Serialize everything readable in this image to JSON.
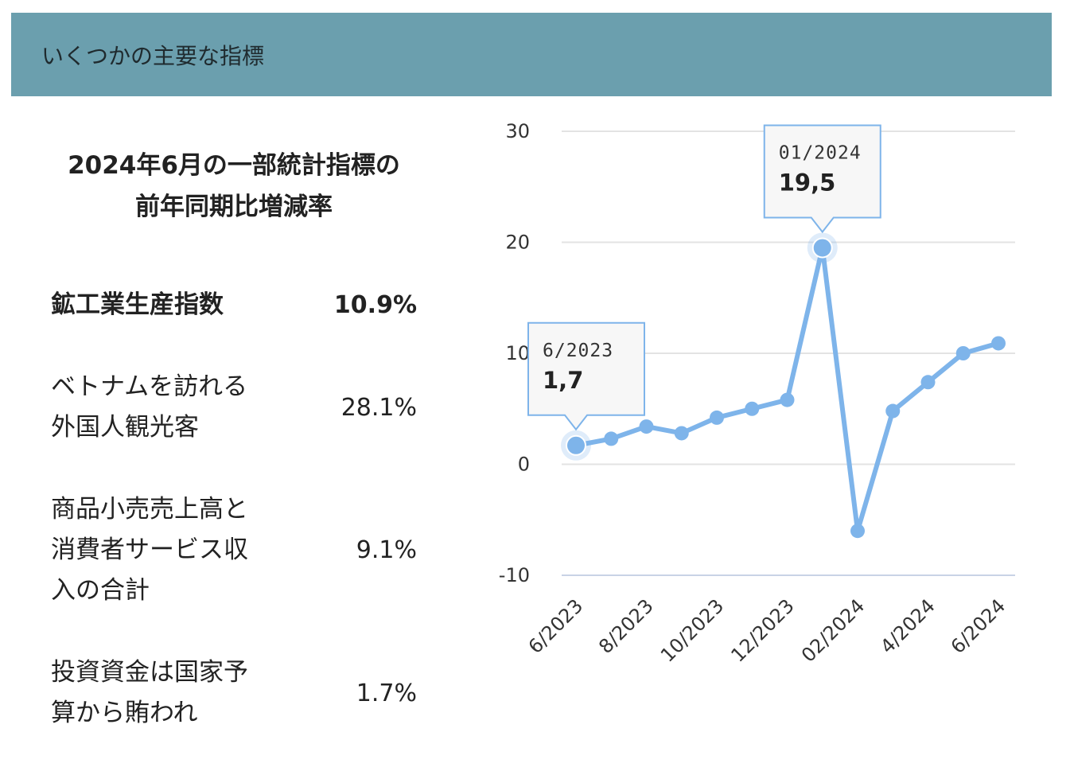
{
  "header": {
    "title": "いくつかの主要な指標"
  },
  "stats": {
    "title_line1": "2024年6月の一部統計指標の",
    "title_line2": "前年同期比増減率",
    "items": [
      {
        "label": "鉱工業生産指数",
        "value": "10.9%"
      },
      {
        "label": "ベトナムを訪れる外国人観光客",
        "value": "28.1%"
      },
      {
        "label": "商品小売売上高と消費者サービス収入の合計",
        "value": "9.1%"
      },
      {
        "label": "投資資金は国家予算から賄われ",
        "value": "1.7%"
      }
    ]
  },
  "colors": {
    "header_bg": "#6b9fae",
    "series": "#7eb4ea",
    "grid": "#e3e3e3"
  },
  "chart_data": {
    "type": "line",
    "x": [
      "6/2023",
      "7/2023",
      "8/2023",
      "9/2023",
      "10/2023",
      "11/2023",
      "12/2023",
      "01/2024",
      "02/2024",
      "3/2024",
      "4/2024",
      "5/2024",
      "6/2024"
    ],
    "x_tick_labels": [
      "6/2023",
      "8/2023",
      "10/2023",
      "12/2023",
      "02/2024",
      "4/2024",
      "6/2024"
    ],
    "series": [
      {
        "values": [
          1.7,
          2.3,
          3.4,
          2.8,
          4.2,
          5.0,
          5.8,
          19.5,
          -6.0,
          4.8,
          7.4,
          10.0,
          10.9
        ]
      }
    ],
    "ylim": [
      -10,
      30
    ],
    "yticks": [
      -10,
      0,
      10,
      20,
      30
    ],
    "grid": true,
    "tooltips": [
      {
        "index": 0,
        "date": "6/2023",
        "value": "1,7"
      },
      {
        "index": 7,
        "date": "01/2024",
        "value": "19,5"
      }
    ]
  }
}
